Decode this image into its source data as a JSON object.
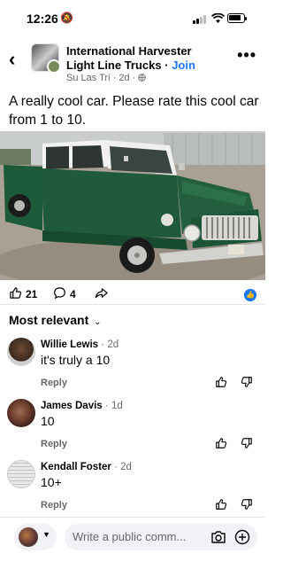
{
  "status_bar": {
    "time": "12:26",
    "battery_level": 0.85
  },
  "group": {
    "name": "International Harvester Light Line Trucks",
    "separator": " · ",
    "join_label": "Join",
    "author": "Su Las Tri",
    "time_ago": "2d",
    "meta_separator": " · "
  },
  "post": {
    "caption": "A really cool car. Please rate this cool car from 1 to 10.",
    "likes": "21",
    "comments": "4"
  },
  "comments_section": {
    "sort_label": "Most relevant",
    "items": [
      {
        "name": "Willie Lewis",
        "time_sep": " · ",
        "time": "2d",
        "text": "it's truly a 10",
        "reply_label": "Reply"
      },
      {
        "name": "James Davis",
        "time_sep": " · ",
        "time": "1d",
        "text": "10",
        "reply_label": "Reply"
      },
      {
        "name": "Kendall Foster",
        "time_sep": " · ",
        "time": "2d",
        "text": "10+",
        "reply_label": "Reply"
      }
    ]
  },
  "composer": {
    "placeholder": "Write a public comm..."
  },
  "colors": {
    "accent": "#1877f2",
    "truck_green": "#1f5a3a",
    "secondary_text": "#65676b"
  },
  "icons": [
    "back-arrow-icon",
    "more-icon",
    "globe-icon",
    "like-icon",
    "comment-icon",
    "share-icon",
    "thumb-up-icon",
    "thumb-down-icon",
    "camera-icon",
    "plus-icon",
    "chevron-down-icon"
  ]
}
